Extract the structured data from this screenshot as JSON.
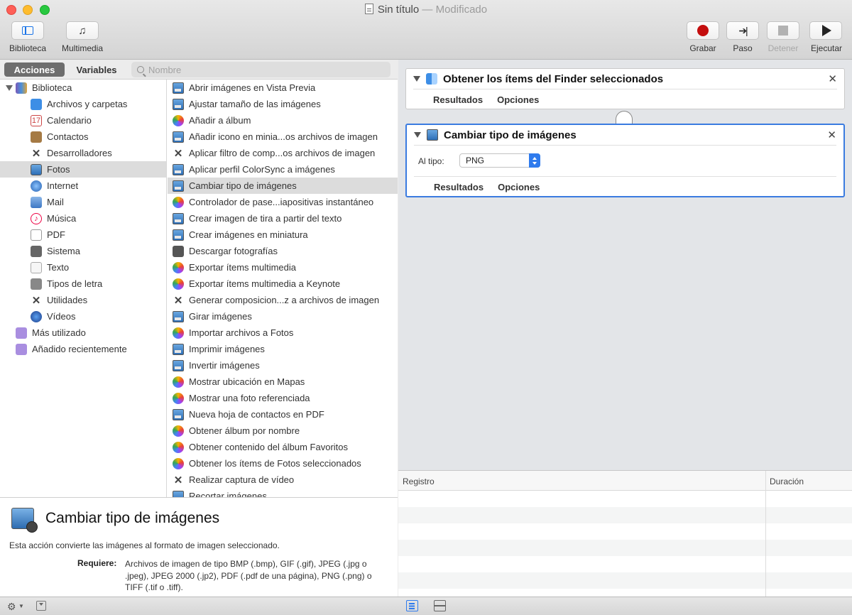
{
  "window": {
    "title": "Sin título",
    "title_suffix": "— Modificado"
  },
  "toolbar": {
    "biblioteca_label": "Biblioteca",
    "multimedia_label": "Multimedia",
    "grabar_label": "Grabar",
    "paso_label": "Paso",
    "detener_label": "Detener",
    "ejecutar_label": "Ejecutar"
  },
  "tabs": {
    "acciones": "Acciones",
    "variables": "Variables"
  },
  "search": {
    "placeholder": "Nombre",
    "value": ""
  },
  "library": {
    "root": "Biblioteca",
    "items": [
      "Archivos y carpetas",
      "Calendario",
      "Contactos",
      "Desarrolladores",
      "Fotos",
      "Internet",
      "Mail",
      "Música",
      "PDF",
      "Sistema",
      "Texto",
      "Tipos de letra",
      "Utilidades",
      "Vídeos"
    ],
    "selected": "Fotos",
    "extra": [
      "Más utilizado",
      "Añadido recientemente"
    ]
  },
  "actions": {
    "items": [
      "Abrir imágenes en Vista Previa",
      "Ajustar tamaño de las imágenes",
      "Añadir a álbum",
      "Añadir icono en minia...os archivos de imagen",
      "Aplicar filtro de comp...os archivos de imagen",
      "Aplicar perfil ColorSync a imágenes",
      "Cambiar tipo de imágenes",
      "Controlador de pase...iapositivas instantáneo",
      "Crear imagen de tira a partir del texto",
      "Crear imágenes en miniatura",
      "Descargar fotografías",
      "Exportar ítems multimedia",
      "Exportar ítems multimedia a Keynote",
      "Generar composicion...z a archivos de imagen",
      "Girar imágenes",
      "Importar archivos a Fotos",
      "Imprimir imágenes",
      "Invertir imágenes",
      "Mostrar ubicación en Mapas",
      "Mostrar una foto referenciada",
      "Nueva hoja de contactos en PDF",
      "Obtener álbum por nombre",
      "Obtener contenido del álbum Favoritos",
      "Obtener los ítems de Fotos seleccionados",
      "Realizar captura de vídeo",
      "Recortar imágenes"
    ],
    "selected": "Cambiar tipo de imágenes"
  },
  "description": {
    "title": "Cambiar tipo de imágenes",
    "text": "Esta acción convierte las imágenes al formato de imagen seleccionado.",
    "requires_label": "Requiere:",
    "requires_text": "Archivos de imagen de tipo BMP (.bmp), GIF (.gif), JPEG (.jpg o .jpeg), JPEG 2000 (.jp2), PDF (.pdf de una página), PNG (.png) o TIFF (.tif o .tiff)."
  },
  "workflow": {
    "step1": {
      "title": "Obtener los ítems del Finder seleccionados",
      "tab_results": "Resultados",
      "tab_options": "Opciones"
    },
    "step2": {
      "title": "Cambiar tipo de imágenes",
      "field_label": "Al tipo:",
      "field_value": "PNG",
      "tab_results": "Resultados",
      "tab_options": "Opciones"
    }
  },
  "log": {
    "col_registro": "Registro",
    "col_duracion": "Duración"
  },
  "colors": {
    "accent": "#2f7bed",
    "record": "#c40e0e",
    "selection": "#dcdcdc"
  }
}
